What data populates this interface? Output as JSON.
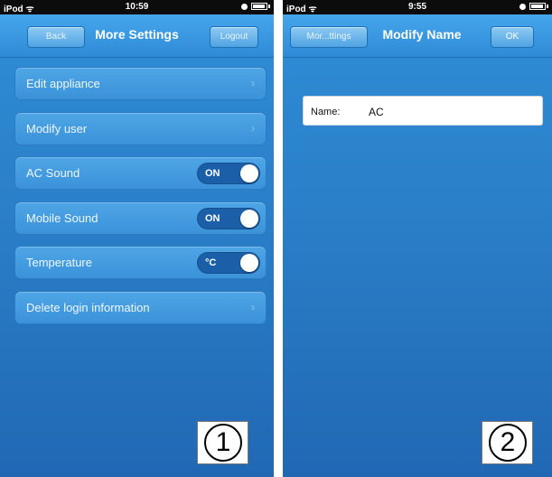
{
  "screen1": {
    "status": {
      "carrier": "iPod ᯤ",
      "time": "10:59"
    },
    "nav": {
      "back": "Back",
      "title": "More Settings",
      "logout": "Logout"
    },
    "menu": [
      {
        "label": "Edit appliance"
      },
      {
        "label": "Modify user"
      },
      {
        "label": "AC Sound",
        "toggle": "ON"
      },
      {
        "label": "Mobile Sound",
        "toggle": "ON"
      },
      {
        "label": "Temperature",
        "toggle": "°C"
      },
      {
        "label": "Delete login information"
      }
    ],
    "badge": "1"
  },
  "screen2": {
    "status": {
      "carrier": "iPod ᯤ",
      "time": "9:55"
    },
    "nav": {
      "back": "Mor...ttings",
      "title": "Modify Name",
      "ok": "OK"
    },
    "name_field": {
      "label": "Name:",
      "value": "AC"
    },
    "badge": "2"
  },
  "icons": {
    "wifi": "wifi-icon",
    "battery": "battery-icon",
    "chevron": "chevron-right-icon"
  },
  "colors": {
    "background": "#2a7fc8",
    "navbar": "#3797df",
    "row": "#469edf",
    "toggle": "#1a5fa8"
  }
}
